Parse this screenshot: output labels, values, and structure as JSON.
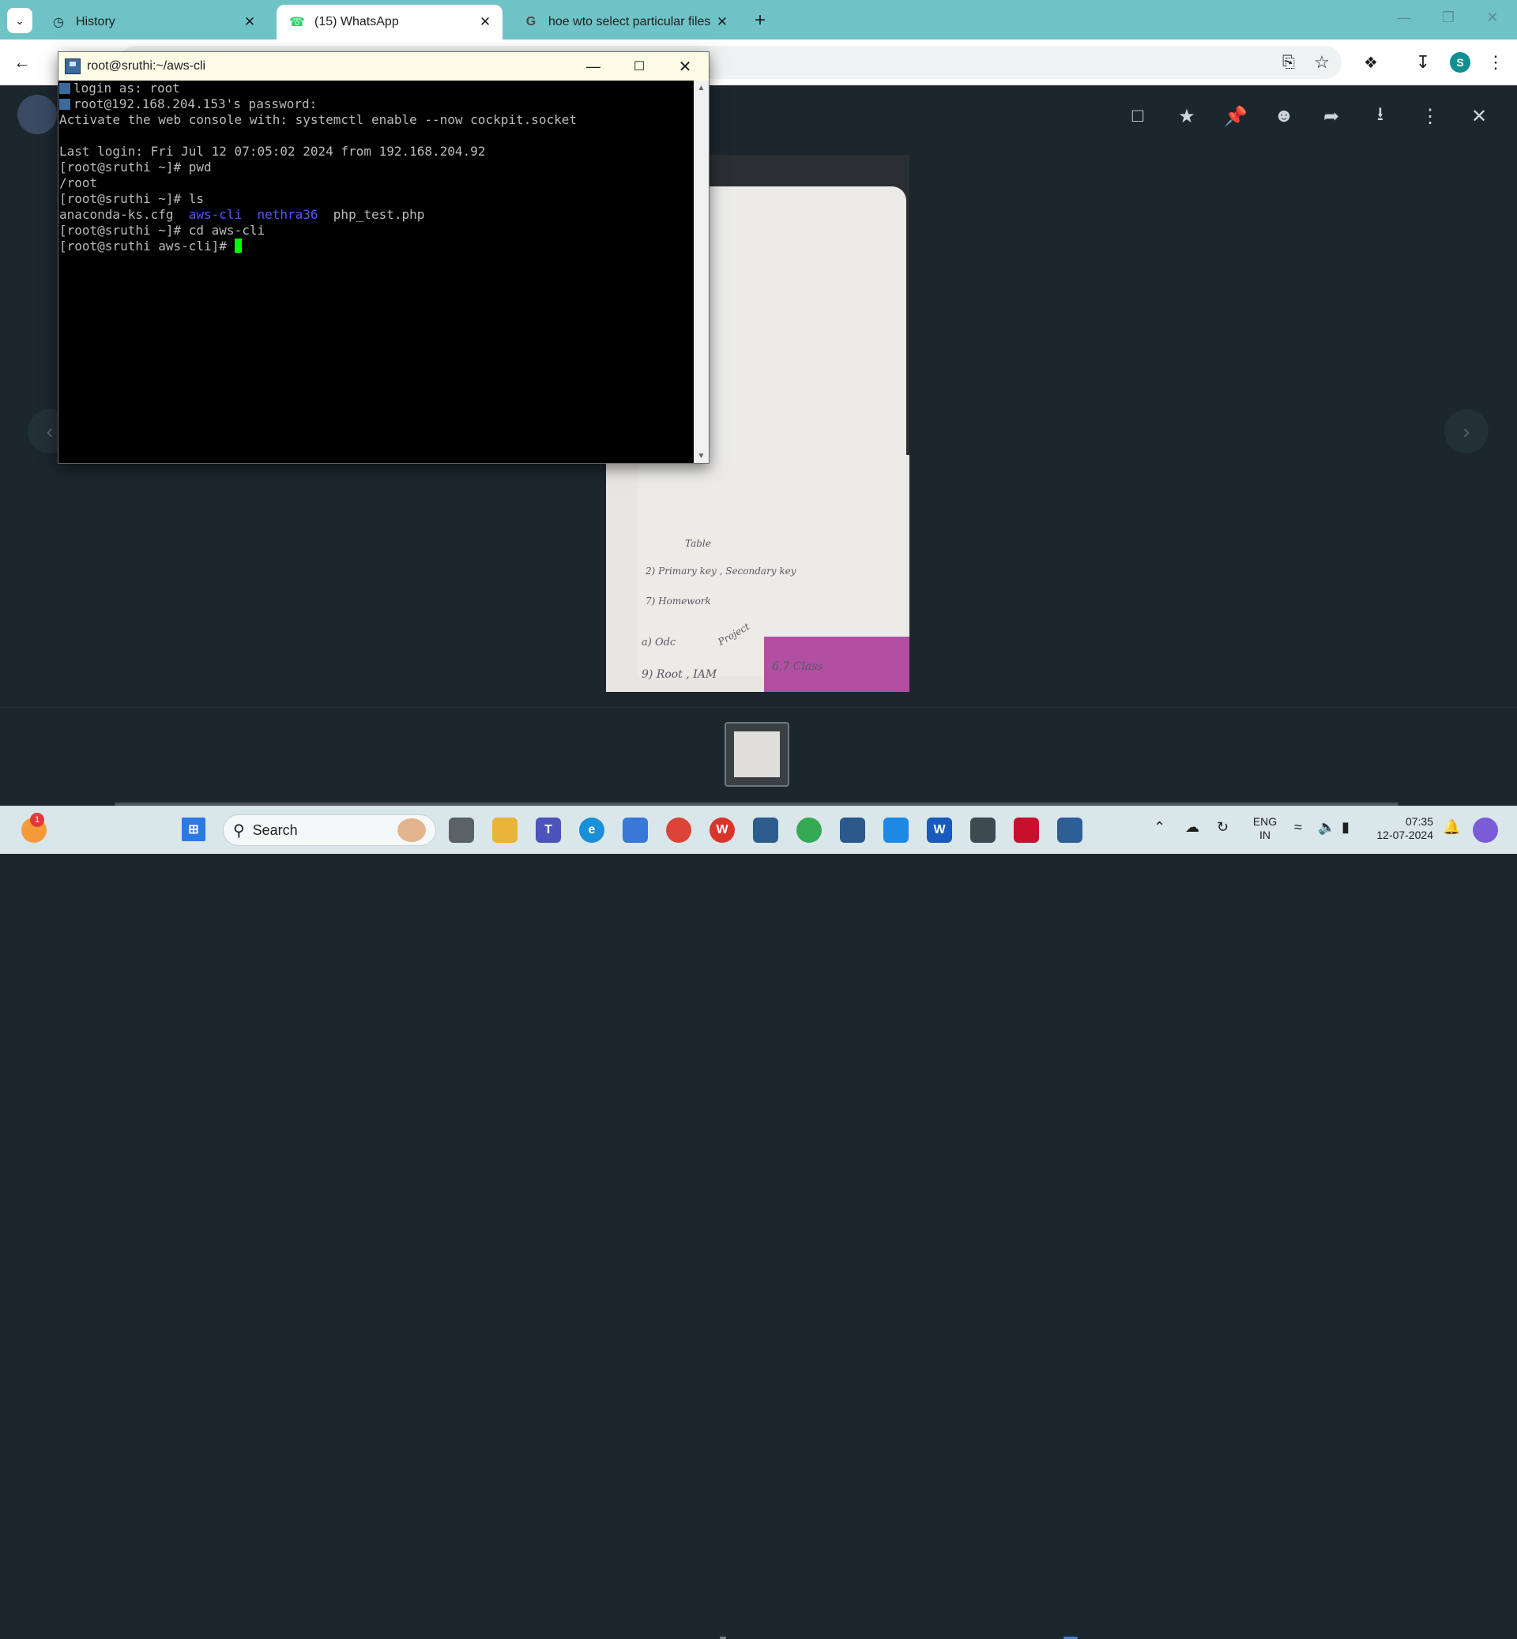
{
  "browser": {
    "tabs": [
      {
        "title": "History",
        "icon": "history-icon",
        "active": false
      },
      {
        "title": "(15) WhatsApp",
        "icon": "whatsapp-icon",
        "active": true
      },
      {
        "title": "hoe wto select particular files to",
        "icon": "google-icon",
        "active": false
      }
    ],
    "profile_initial": "S"
  },
  "putty": {
    "title": "root@sruthi:~/aws-cli",
    "lines": [
      "login as: root",
      "root@192.168.204.153's password:",
      "Activate the web console with: systemctl enable --now cockpit.socket",
      "",
      "Last login: Fri Jul 12 07:05:02 2024 from 192.168.204.92",
      "[root@sruthi ~]# pwd",
      "/root",
      "[root@sruthi ~]# ls"
    ],
    "ls_output": {
      "file1": "anaconda-ks.cfg",
      "dir1": "aws-cli",
      "dir2": "nethra36",
      "file2": "php_test.php"
    },
    "line_cd": "[root@sruthi ~]# cd aws-cli",
    "prompt": "[root@sruthi aws-cli]# ",
    "colors": {
      "background": "#000000",
      "text": "#bbbbbb",
      "directory": "#5454ff",
      "cursor": "#00ff00"
    }
  },
  "photo_notes": [
    "Table",
    "2) Primary key , Secondary key",
    "7) Homework",
    "a) Odc",
    "Project",
    "6,7 Class",
    "9) Root , IAM"
  ],
  "taskbar": {
    "search_label": "Search",
    "language": "ENG",
    "region": "IN",
    "time": "07:35",
    "date": "12-07-2024",
    "notification_count": "1"
  },
  "colors": {
    "tabstrip": "#6fc2c6",
    "viewer_bg": "#1b262d",
    "taskbar": "#d9e6ea"
  }
}
